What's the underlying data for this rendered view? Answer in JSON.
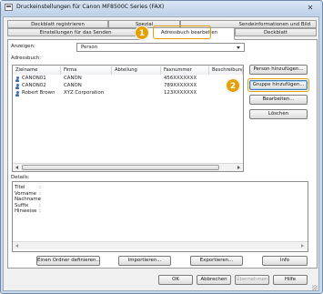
{
  "window": {
    "title": "Druckeinstellungen für Canon MF8500C Series (FAX)",
    "close_glyph": "✕"
  },
  "tabs": {
    "row1": [
      "Deckblatt registrieren",
      "Spezial",
      "Sendeinformationen und Bild"
    ],
    "row2": [
      "Einstellungen für das Senden",
      "Adressbuch bearbeiten",
      "Deckblatt"
    ]
  },
  "callouts": [
    "1",
    "2"
  ],
  "view_label": "Anzeigen:",
  "view_value": "Person",
  "addressbook_label": "Adressbuch:",
  "columns": [
    "Zielname",
    "Firma",
    "Abteilung",
    "Faxnummer",
    "Beschreibung"
  ],
  "rows": [
    {
      "name": "CANON01",
      "firma": "CANON",
      "abteilung": "",
      "fax": "456XXXXXXX"
    },
    {
      "name": "CANON02",
      "firma": "CANON",
      "abteilung": "",
      "fax": "789XXXXXXX"
    },
    {
      "name": "Robert Brown",
      "firma": "XYZ Corporation",
      "abteilung": "",
      "fax": "123XXXXXXX"
    }
  ],
  "side_buttons": {
    "add_person": "Person hinzufügen...",
    "add_group": "Gruppe hinzufügen...",
    "edit": "Bearbeiten...",
    "delete": "Löschen"
  },
  "details": {
    "label": "Details:",
    "fields": [
      {
        "name": "Titel",
        "value": ":"
      },
      {
        "name": "Vorname",
        "value": ":"
      },
      {
        "name": "Nachname",
        "value": ":"
      },
      {
        "name": "Suffix",
        "value": ":"
      },
      {
        "name": "Hinweise",
        "value": ":"
      }
    ]
  },
  "bottom_buttons": {
    "new_folder": "Einen Ordner definieren...",
    "import": "Importieren...",
    "export": "Exportieren...",
    "info": "Info"
  },
  "dialog_buttons": {
    "ok": "OK",
    "cancel": "Abbrechen",
    "apply": "Übernehmen",
    "help": "Hilfe"
  },
  "colors": {
    "accent": "#e3a000",
    "window_frame": "#c9d9ec"
  }
}
